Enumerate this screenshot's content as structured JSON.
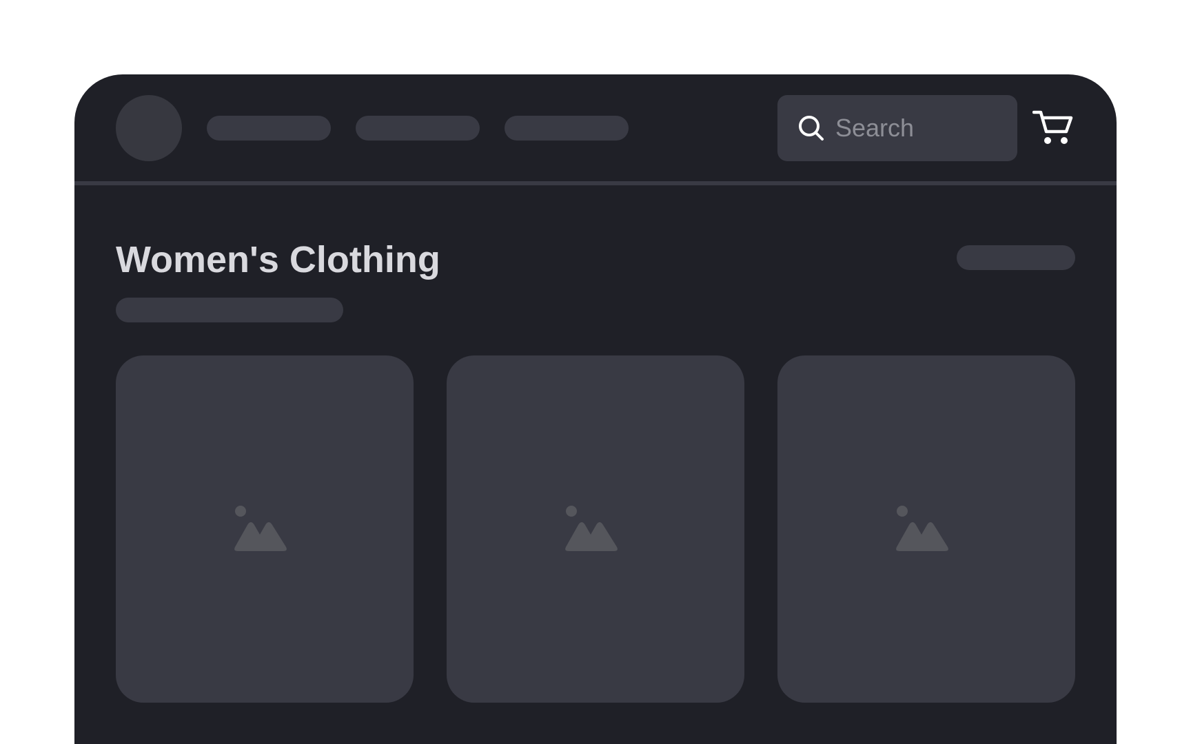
{
  "header": {
    "search": {
      "placeholder": "Search"
    },
    "icons": {
      "search": "search-icon",
      "cart": "cart-icon",
      "logo": "logo-placeholder"
    }
  },
  "main": {
    "title": "Women's Clothing",
    "products": [
      {
        "image_icon": "image-placeholder-icon"
      },
      {
        "image_icon": "image-placeholder-icon"
      },
      {
        "image_icon": "image-placeholder-icon"
      }
    ]
  },
  "colors": {
    "page_background": "#ffffff",
    "app_background": "#1f2027",
    "placeholder_fill": "#393a44",
    "title_text": "#d9d9de",
    "muted_text": "#8d8e96",
    "icon_light": "#ffffff",
    "image_icon": "#55565c"
  }
}
